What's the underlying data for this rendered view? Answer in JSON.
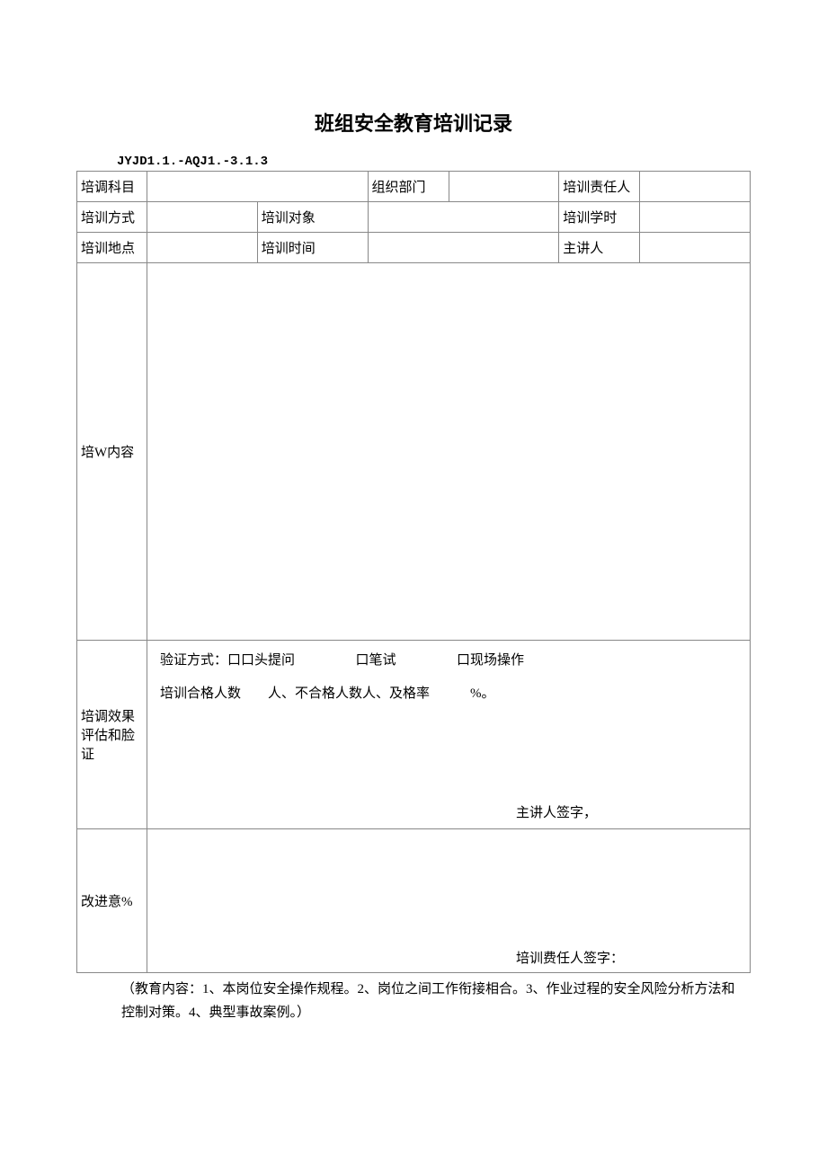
{
  "title": "班组安全教育培训记录",
  "formCode": "JYJD1.1.-AQJ1.-3.1.3",
  "labels": {
    "subject": "培调科目",
    "orgDept": "组织部门",
    "trainResp": "培训责任人",
    "method": "培训方式",
    "target": "培训对象",
    "hours": "培训学时",
    "location": "培训地点",
    "time": "培训时间",
    "speaker": "主讲人",
    "content": "培W内容",
    "eval": "培调效果评估和脸证",
    "improve": "改进意%"
  },
  "eval": {
    "verifyPrefix": "验证方式：",
    "oral": "口口头提问",
    "written": "口笔试",
    "onsite": "口现场操作",
    "passLine": "培训合格人数　　人、不合格人数人、及格率　　　%。",
    "speakerSign": "主讲人签字，"
  },
  "improveSign": "培训费任人签字：",
  "footerNote": "（教育内容：1、本岗位安全操作规程。2、岗位之间工作衔接相合。3、作业过程的安全风险分析方法和控制对策。4、典型事故案例。）"
}
